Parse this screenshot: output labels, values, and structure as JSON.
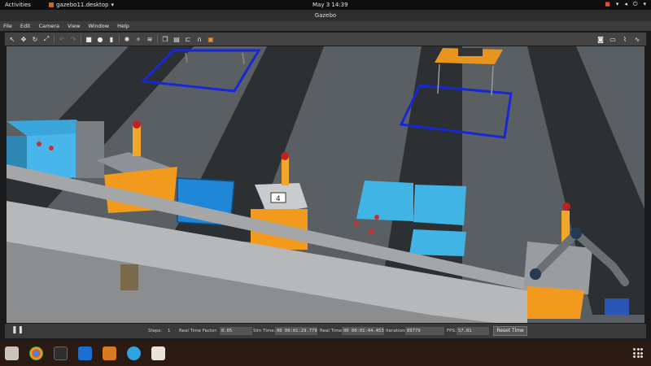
{
  "topbar": {
    "activities": "Activities",
    "app_name": "gazebo11.desktop",
    "clock": "May 3  14:39"
  },
  "window": {
    "title": "Gazebo"
  },
  "menu": {
    "items": [
      "File",
      "Edit",
      "Camera",
      "View",
      "Window",
      "Help"
    ]
  },
  "toolbar": {
    "tools": [
      "select-arrow-icon",
      "translate-icon",
      "rotate-icon",
      "scale-icon",
      "undo-icon",
      "redo-icon",
      "box-icon",
      "sphere-icon",
      "cylinder-icon",
      "point-light-icon",
      "spot-light-icon",
      "directional-light-icon",
      "copy-icon",
      "paste-icon",
      "align-icon",
      "snap-icon",
      "change-view-icon"
    ],
    "right_tools": [
      "screenshot-icon",
      "record-icon",
      "plot-icon",
      "graph-icon"
    ]
  },
  "statusbar": {
    "steps_label": "Steps:",
    "steps_value": "1",
    "rtf_label": "Real Time Factor:",
    "rtf_value": "0.65",
    "sim_time_label": "Sim Time:",
    "sim_time_value": "00 00:01:29.779",
    "real_time_label": "Real Time:",
    "real_time_value": "00 00:01:44.453",
    "iterations_label": "Iterations:",
    "iterations_value": "89779",
    "fps_label": "FPS:",
    "fps_value": "57.81",
    "reset_label": "Reset Time"
  },
  "scene": {
    "sign_text": "4"
  },
  "colors": {
    "ground": "#5a5f63",
    "lane": "#2c2f31",
    "bin_blue": "#1f86d8",
    "table_cyan": "#41b4e6",
    "robot_orange": "#f29a1e",
    "marker_blue": "#1627d8"
  },
  "dock": {
    "apps": [
      "files-icon",
      "chrome-icon",
      "terminal-icon",
      "vscode-icon",
      "gazebo-icon",
      "telegram-icon",
      "pdf-icon"
    ]
  }
}
